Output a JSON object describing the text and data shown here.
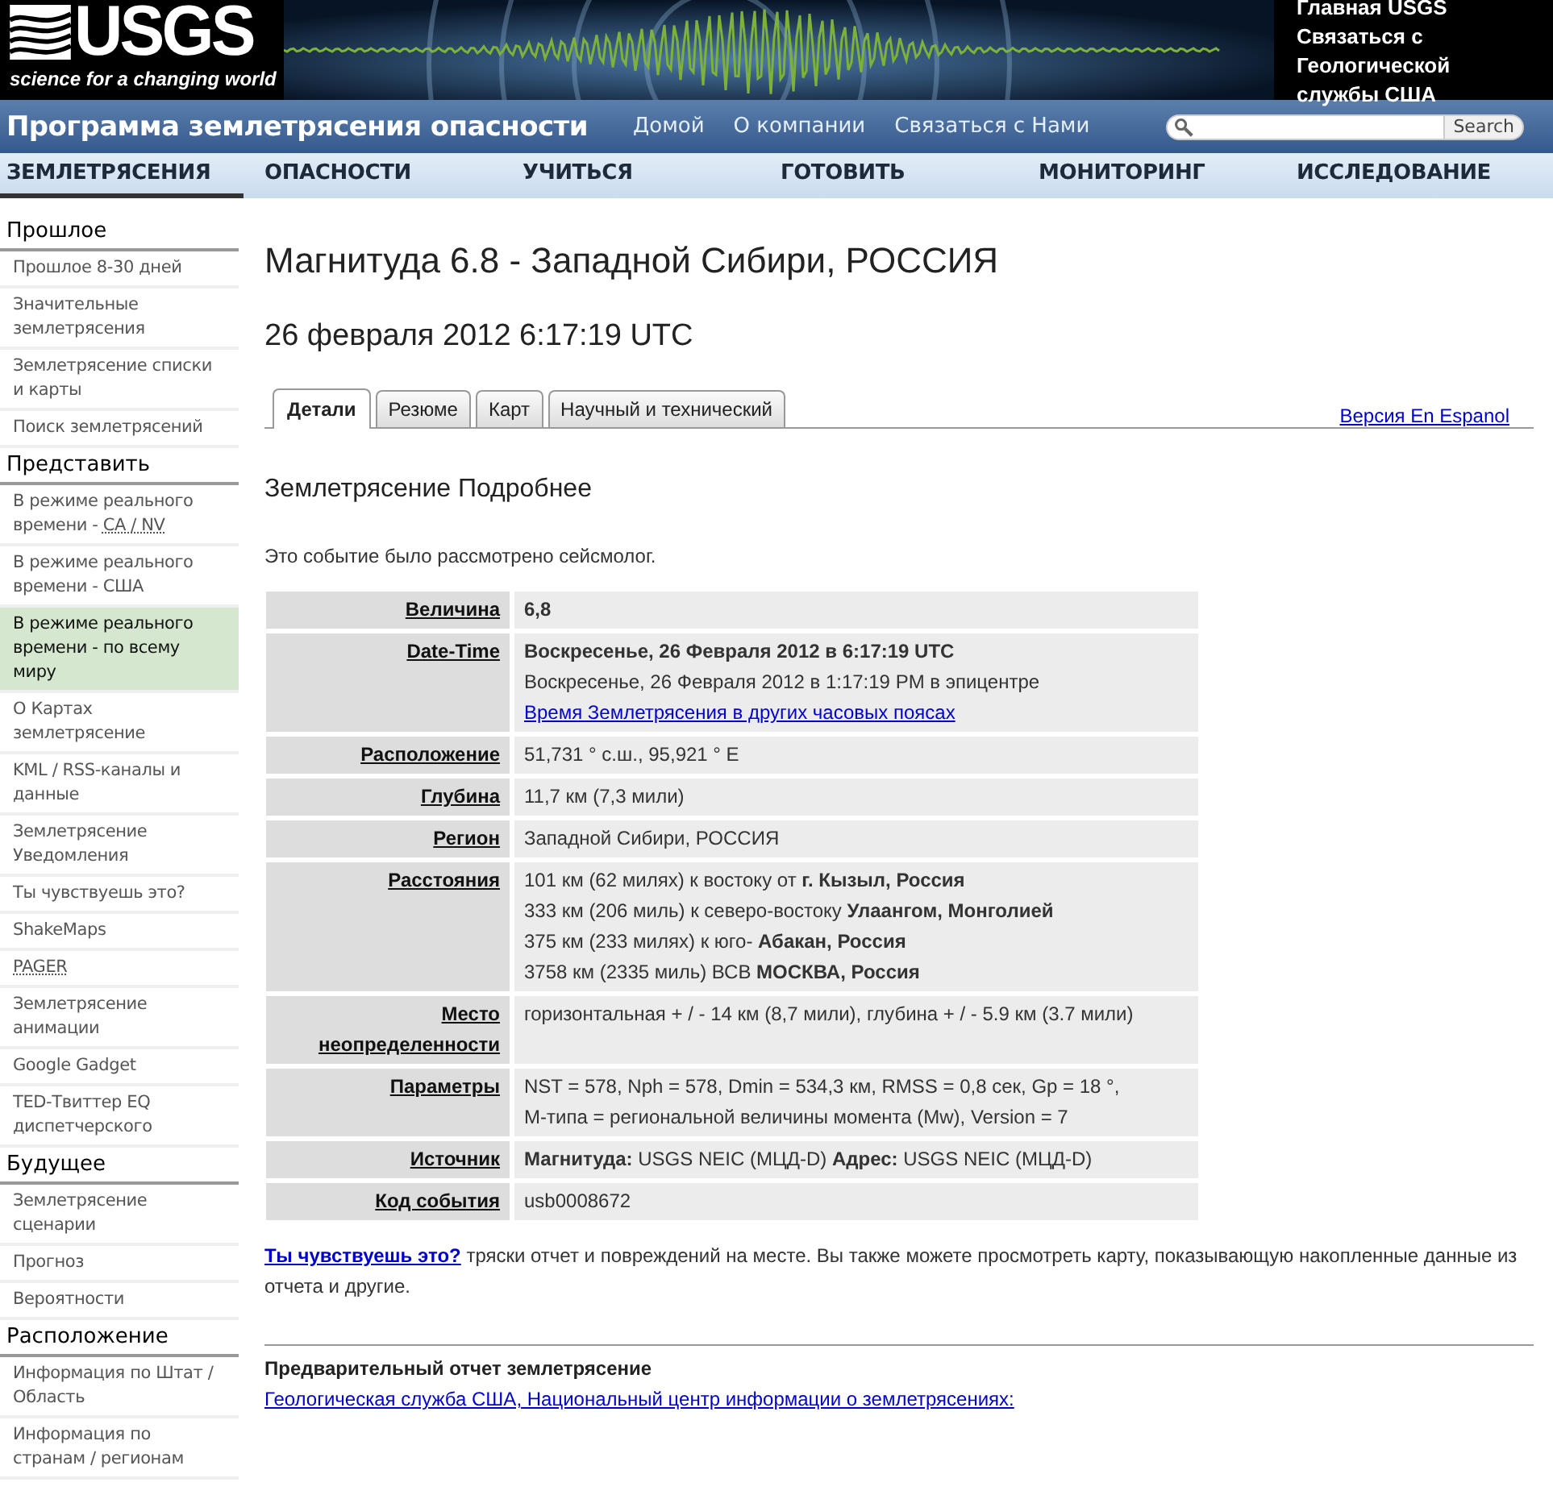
{
  "header": {
    "logo_text": "USGS",
    "tagline": "science for a changing world",
    "links": [
      "Главная USGS",
      "Связаться с Геологической службы США"
    ]
  },
  "title_bar": {
    "title": "Программа землетрясения опасности",
    "links": [
      "Домой",
      "О компании",
      "Связаться с Нами"
    ],
    "search_button": "Search"
  },
  "nav": [
    {
      "label": "ЗЕМЛЕТРЯСЕНИЯ",
      "selected": true
    },
    {
      "label": "ОПАСНОСТИ",
      "selected": false
    },
    {
      "label": "УЧИТЬСЯ",
      "selected": false
    },
    {
      "label": "ГОТОВИТЬ",
      "selected": false
    },
    {
      "label": "МОНИТОРИНГ",
      "selected": false
    },
    {
      "label": "ИССЛЕДОВАНИЕ",
      "selected": false
    }
  ],
  "sidebar": [
    {
      "heading": "Прошлое",
      "items": [
        {
          "label": "Прошлое 8-30 дней",
          "selected": false
        },
        {
          "label": "Значительные землетрясения",
          "selected": false
        },
        {
          "label": "Землетрясение списки и карты",
          "selected": false
        },
        {
          "label": "Поиск землетрясений",
          "selected": false
        }
      ]
    },
    {
      "heading": "Представить",
      "items": [
        {
          "label": "В режиме реального времени -",
          "abbr": "CA / NV",
          "selected": false
        },
        {
          "label": "В режиме реального времени - США",
          "selected": false
        },
        {
          "label": "В режиме реального времени - по всему миру",
          "selected": true
        },
        {
          "label": "О Картах землетрясение",
          "selected": false
        },
        {
          "label": "KML / RSS-каналы и данные",
          "selected": false
        },
        {
          "label": "Землетрясение Уведомления",
          "selected": false
        },
        {
          "label": "Ты чувствуешь это?",
          "selected": false
        },
        {
          "label": "ShakeMaps",
          "selected": false
        },
        {
          "abbr": "PAGER",
          "selected": false
        },
        {
          "label": "Землетрясение анимации",
          "selected": false
        },
        {
          "label": "Google Gadget",
          "selected": false
        },
        {
          "label": "TED-Твиттер EQ диспетчерского",
          "selected": false
        }
      ]
    },
    {
      "heading": "Будущее",
      "items": [
        {
          "label": "Землетрясение сценарии",
          "selected": false
        },
        {
          "label": "Прогноз",
          "selected": false
        },
        {
          "label": "Вероятности",
          "selected": false
        }
      ]
    },
    {
      "heading": "Расположение",
      "items": [
        {
          "label": "Информация по Штат / Область",
          "selected": false
        },
        {
          "label": "Информация по странам / регионам",
          "selected": false
        }
      ]
    }
  ],
  "event": {
    "title": "Магнитуда 6.8 - Западной Сибири, РОССИЯ",
    "datetime": "26 февраля 2012 6:17:19 UTC"
  },
  "tabs": [
    {
      "label": "Детали",
      "selected": true
    },
    {
      "label": "Резюме",
      "selected": false
    },
    {
      "label": "Карт",
      "selected": false
    },
    {
      "label": "Научный и технический",
      "selected": false
    }
  ],
  "language_link": "Версия En Espanol",
  "section_title": "Землетрясение Подробнее",
  "intro": "Это событие было рассмотрено сейсмолог.",
  "details": [
    {
      "label": "Величина",
      "lines": [
        {
          "kind": "bold",
          "text": "6,8"
        }
      ]
    },
    {
      "label": "Date-Time",
      "lines": [
        {
          "kind": "bold",
          "text": "Воскресенье, 26 Февраля 2012 в 6:17:19 UTC"
        },
        {
          "kind": "text",
          "text": "Воскресенье, 26 Февраля 2012 в 1:17:19 PM в эпицентре"
        },
        {
          "kind": "link",
          "text": "Время Землетрясения в других часовых поясах"
        }
      ]
    },
    {
      "label": "Расположение",
      "lines": [
        {
          "kind": "text",
          "text": "51,731 ° с.ш., 95,921 ° E"
        }
      ]
    },
    {
      "label": "Глубина",
      "lines": [
        {
          "kind": "text",
          "text": "11,7 км (7,3 мили)"
        }
      ]
    },
    {
      "label": "Регион",
      "lines": [
        {
          "kind": "text",
          "text": "Западной Сибири, РОССИЯ"
        }
      ]
    },
    {
      "label": "Расстояния",
      "lines": [
        {
          "kind": "text",
          "text": "101 км (62 милях) к востоку от **г. Кызыл, Россия**"
        },
        {
          "kind": "text",
          "text": "333 км (206 миль) к северо-востоку **Улаангом, Монголией**"
        },
        {
          "kind": "text",
          "text": "375 км (233 милях) к юго- **Абакан, Россия**"
        },
        {
          "kind": "text",
          "text": "3758 км (2335 миль) ВСВ **МОСКВА, Россия**"
        }
      ]
    },
    {
      "label": "Место неопределенности",
      "lines": [
        {
          "kind": "text",
          "text": "горизонтальная + / - 14 км (8,7 мили), глубина + / - 5.9 км (3.7 мили)"
        }
      ]
    },
    {
      "label": "Параметры",
      "lines": [
        {
          "kind": "text",
          "text": "NST = 578, Nph = 578, Dmin = 534,3 км, RMSS = 0,8 сек, Gp = 18 °,"
        },
        {
          "kind": "text",
          "text": "M-типа = региональной величины момента (Mw), Version = 7"
        }
      ]
    },
    {
      "label": "Источник",
      "lines": [
        {
          "kind": "text",
          "text": "**Магнитуда:** USGS NEIC (МЦД-D) **Адрес:** USGS NEIC (МЦД-D)"
        }
      ]
    },
    {
      "label": "Код события",
      "lines": [
        {
          "kind": "text",
          "text": "usb0008672"
        }
      ]
    }
  ],
  "felt": {
    "link": "Ты чувствуешь это?",
    "text": "тряски отчет и повреждений на месте. Вы также можете просмотреть карту, показывающую накопленные данные из отчета и другие."
  },
  "report": {
    "title": "Предварительный отчет землетрясение",
    "link": "Геологическая служба США, Национальный центр информации о землетрясениях:"
  }
}
